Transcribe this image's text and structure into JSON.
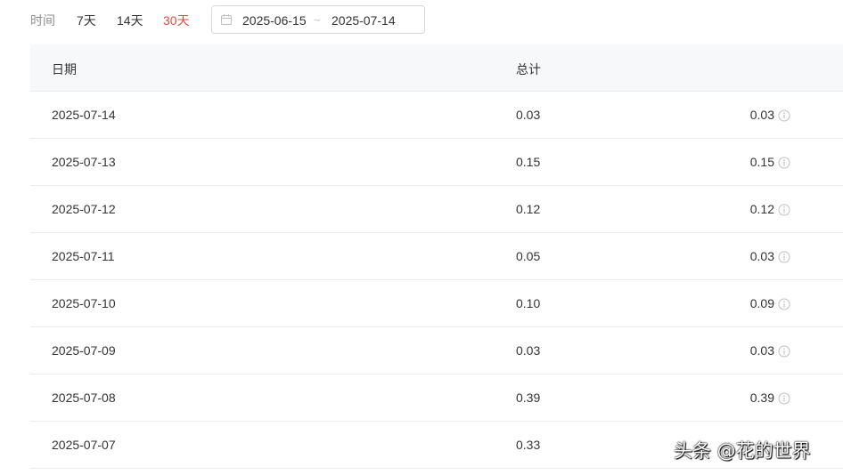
{
  "filter": {
    "label": "时间",
    "ranges": [
      "7天",
      "14天",
      "30天"
    ],
    "active_range": "30天",
    "date_start": "2025-06-15",
    "date_separator": "~",
    "date_end": "2025-07-14"
  },
  "table": {
    "headers": [
      "日期",
      "总计",
      ""
    ],
    "rows": [
      {
        "date": "2025-07-14",
        "total": "0.03",
        "value": "0.03"
      },
      {
        "date": "2025-07-13",
        "total": "0.15",
        "value": "0.15"
      },
      {
        "date": "2025-07-12",
        "total": "0.12",
        "value": "0.12"
      },
      {
        "date": "2025-07-11",
        "total": "0.05",
        "value": "0.03"
      },
      {
        "date": "2025-07-10",
        "total": "0.10",
        "value": "0.09"
      },
      {
        "date": "2025-07-09",
        "total": "0.03",
        "value": "0.03"
      },
      {
        "date": "2025-07-08",
        "total": "0.39",
        "value": "0.39"
      },
      {
        "date": "2025-07-07",
        "total": "0.33",
        "value": ""
      }
    ]
  },
  "watermark": "头条 @花的世界",
  "colors": {
    "accent": "#e04a3b",
    "header_bg": "#f7f8fa",
    "border": "#ebebeb",
    "icon": "#bfbfbf"
  }
}
